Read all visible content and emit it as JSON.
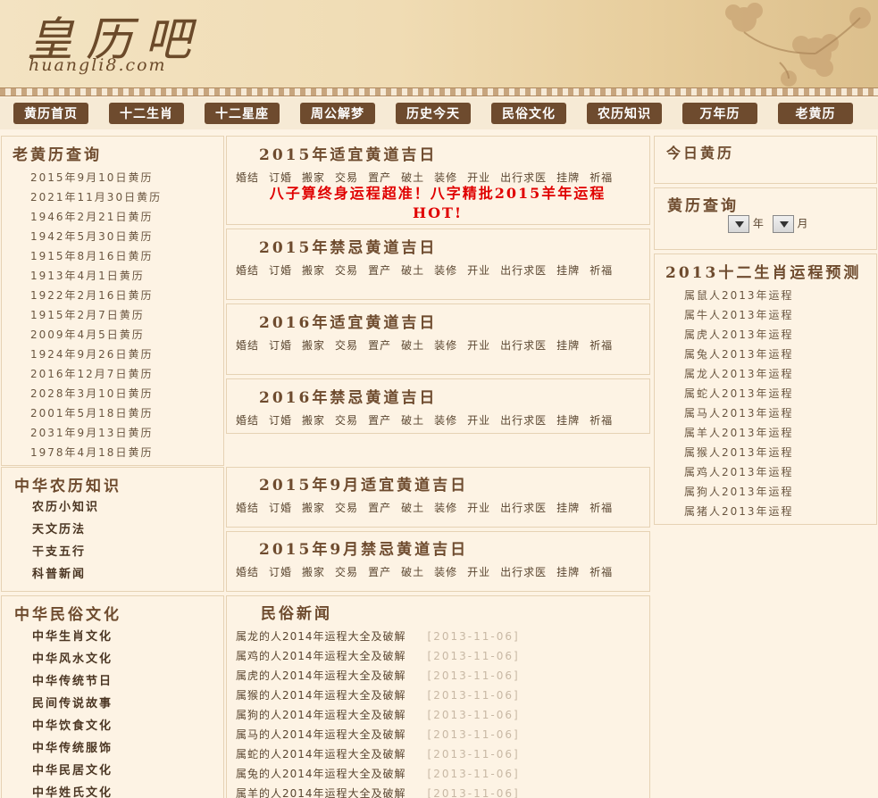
{
  "header": {
    "logo": "皇历吧",
    "domain": "huangli8.com"
  },
  "nav": [
    "黄历首页",
    "十二生肖",
    "十二星座",
    "周公解梦",
    "历史今天",
    "民俗文化",
    "农历知识",
    "万年历",
    "老黄历"
  ],
  "left": {
    "query": {
      "title": "老黄历查询",
      "items": [
        "2015年9月10日黄历",
        "2021年11月30日黄历",
        "1946年2月21日黄历",
        "1942年5月30日黄历",
        "1915年8月16日黄历",
        "1913年4月1日黄历",
        "1922年2月16日黄历",
        "1915年2月7日黄历",
        "2009年4月5日黄历",
        "1924年9月26日黄历",
        "2016年12月7日黄历",
        "2028年3月10日黄历",
        "2001年5月18日黄历",
        "2031年9月13日黄历",
        "1978年4月18日黄历"
      ]
    },
    "lunar": {
      "title": "中华农历知识",
      "items": [
        "农历小知识",
        "天文历法",
        "干支五行",
        "科普新闻"
      ]
    },
    "folk": {
      "title": "中华民俗文化",
      "items": [
        "中华生肖文化",
        "中华风水文化",
        "中华传统节日",
        "民间传说故事",
        "中华饮食文化",
        "中华传统服饰",
        "中华民居文化",
        "中华姓氏文化"
      ]
    }
  },
  "center": {
    "words": [
      "婚结",
      "订婚",
      "搬家",
      "交易",
      "置产",
      "破土",
      "装修",
      "开业",
      "出行求医",
      "挂牌",
      "祈福"
    ],
    "hot_line1": "八子算终身运程超准！八字精批2015羊年运程",
    "hot_line2": "HOT!",
    "sections": [
      "2015年适宜黄道吉日",
      "2015年禁忌黄道吉日",
      "2016年适宜黄道吉日",
      "2016年禁忌黄道吉日",
      "2015年9月适宜黄道吉日",
      "2015年9月禁忌黄道吉日"
    ],
    "news": {
      "title": "民俗新闻",
      "items": [
        {
          "text": "属龙的人2014年运程大全及破解",
          "date": "[2013-11-06]"
        },
        {
          "text": "属鸡的人2014年运程大全及破解",
          "date": "[2013-11-06]"
        },
        {
          "text": "属虎的人2014年运程大全及破解",
          "date": "[2013-11-06]"
        },
        {
          "text": "属猴的人2014年运程大全及破解",
          "date": "[2013-11-06]"
        },
        {
          "text": "属狗的人2014年运程大全及破解",
          "date": "[2013-11-06]"
        },
        {
          "text": "属马的人2014年运程大全及破解",
          "date": "[2013-11-06]"
        },
        {
          "text": "属蛇的人2014年运程大全及破解",
          "date": "[2013-11-06]"
        },
        {
          "text": "属兔的人2014年运程大全及破解",
          "date": "[2013-11-06]"
        },
        {
          "text": "属羊的人2014年运程大全及破解",
          "date": "[2013-11-06]"
        }
      ]
    }
  },
  "right": {
    "today": {
      "title": "今日黄历"
    },
    "lookup": {
      "title": "黄历查询",
      "year_unit": "年",
      "month_unit": "月"
    },
    "zodiac": {
      "title": "2013十二生肖运程预测",
      "items": [
        "属鼠人2013年运程",
        "属牛人2013年运程",
        "属虎人2013年运程",
        "属兔人2013年运程",
        "属龙人2013年运程",
        "属蛇人2013年运程",
        "属马人2013年运程",
        "属羊人2013年运程",
        "属猴人2013年运程",
        "属鸡人2013年运程",
        "属狗人2013年运程",
        "属猪人2013年运程"
      ]
    }
  }
}
